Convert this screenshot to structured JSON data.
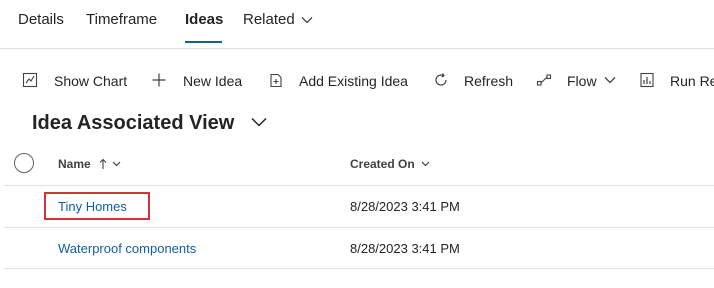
{
  "tabs": [
    {
      "label": "Details"
    },
    {
      "label": "Timeframe"
    },
    {
      "label": "Ideas"
    },
    {
      "label": "Related"
    }
  ],
  "colors": {
    "accent": "#115ea3",
    "highlight": "#d13438"
  },
  "toolbar": {
    "show_chart": "Show Chart",
    "new_idea": "New Idea",
    "add_existing": "Add Existing Idea",
    "refresh": "Refresh",
    "flow": "Flow",
    "run_report": "Run Re"
  },
  "view": {
    "title": "Idea Associated View"
  },
  "grid": {
    "columns": {
      "name": "Name",
      "created_on": "Created On"
    },
    "rows": [
      {
        "name": "Tiny Homes",
        "created_on": "8/28/2023 3:41 PM"
      },
      {
        "name": "Waterproof components",
        "created_on": "8/28/2023 3:41 PM"
      }
    ]
  }
}
